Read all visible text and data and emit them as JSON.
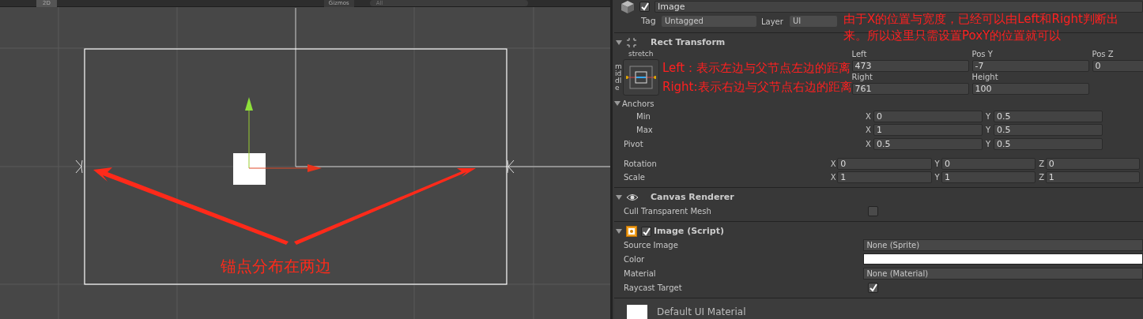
{
  "scene_toolbar": {
    "mode_button": "2D",
    "gizmos": "Gizmos",
    "search": {
      "placeholder": "All"
    }
  },
  "scene": {
    "annotation": "锚点分布在两边"
  },
  "inspector": {
    "object": {
      "name": "Image",
      "active": true,
      "tag_label": "Tag",
      "tag": "Untagged",
      "layer_label": "Layer",
      "layer": "UI"
    },
    "note": "由于X的位置与宽度，已经可以由Left和Right判断出来。所以这里只需设置PoxY的位置就可以",
    "rect_transform": {
      "title": "Rect Transform",
      "expanded": true,
      "anchor_h": "stretch",
      "anchor_v": "middle",
      "notes": [
        "Left：表示左边与父节点左边的距离",
        "Right:表示右边与父节点右边的距离"
      ],
      "fields": [
        [
          {
            "label": "Left",
            "value": "473"
          },
          {
            "label": "Pos Y",
            "value": "-7"
          },
          {
            "label": "Pos Z",
            "value": "0"
          }
        ],
        [
          {
            "label": "Right",
            "value": "761"
          },
          {
            "label": "Height",
            "value": "100"
          }
        ]
      ],
      "anchors": {
        "label": "Anchors",
        "expanded": true,
        "rows": [
          {
            "label": "Min",
            "axes": [
              {
                "axis": "X",
                "value": "0"
              },
              {
                "axis": "Y",
                "value": "0.5"
              }
            ]
          },
          {
            "label": "Max",
            "axes": [
              {
                "axis": "X",
                "value": "1"
              },
              {
                "axis": "Y",
                "value": "0.5"
              }
            ]
          }
        ]
      },
      "rows": [
        {
          "label": "Pivot",
          "axes": [
            {
              "axis": "X",
              "value": "0.5"
            },
            {
              "axis": "Y",
              "value": "0.5"
            }
          ]
        },
        {
          "label": "Rotation",
          "axes": [
            {
              "axis": "X",
              "value": "0"
            },
            {
              "axis": "Y",
              "value": "0"
            },
            {
              "axis": "Z",
              "value": "0"
            }
          ]
        },
        {
          "label": "Scale",
          "axes": [
            {
              "axis": "X",
              "value": "1"
            },
            {
              "axis": "Y",
              "value": "1"
            },
            {
              "axis": "Z",
              "value": "1"
            }
          ]
        }
      ]
    },
    "canvas_renderer": {
      "title": "Canvas Renderer",
      "expanded": true,
      "props": [
        {
          "kind": "checkbox",
          "label": "Cull Transparent Mesh",
          "checked": false
        }
      ]
    },
    "image_script": {
      "title": "Image (Script)",
      "expanded": true,
      "enabled": true,
      "props": [
        {
          "kind": "object",
          "label": "Source Image",
          "value": "None (Sprite)"
        },
        {
          "kind": "color",
          "label": "Color",
          "color": "#ffffff"
        },
        {
          "kind": "object",
          "label": "Material",
          "value": "None (Material)"
        },
        {
          "kind": "checkbox",
          "label": "Raycast Target",
          "checked": true
        }
      ]
    },
    "material": {
      "name": "Default UI Material"
    }
  }
}
